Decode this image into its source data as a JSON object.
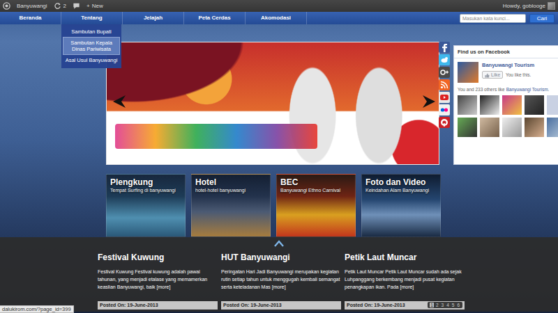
{
  "admin_bar": {
    "site": "Banyuwangi",
    "updates": "2",
    "new_icon": "+",
    "new_label": "New",
    "greeting": "Howdy, goblooge"
  },
  "nav": {
    "items": [
      {
        "label": "Beranda",
        "expanded": false
      },
      {
        "label": "Tentang",
        "expanded": true,
        "children": [
          {
            "label": "Sambutan Bupati",
            "selected": false
          },
          {
            "label": "Sambutan Kepala Dinas Pariwisata",
            "selected": true
          },
          {
            "label": "Asal Usul Banyuwangi",
            "selected": false
          }
        ]
      },
      {
        "label": "Jelajah",
        "expanded": false
      },
      {
        "label": "Peta Cerdas",
        "expanded": false
      },
      {
        "label": "Akomodasi",
        "expanded": false
      }
    ]
  },
  "search": {
    "placeholder": "Masukan kata kunci...",
    "button": "Cari"
  },
  "social": [
    {
      "kind": "facebook",
      "color": "#3b5998"
    },
    {
      "kind": "twitter",
      "color": "#3fb8ec"
    },
    {
      "kind": "googleplus",
      "color": "#4a4a4a"
    },
    {
      "kind": "rss",
      "color": "#f26522"
    },
    {
      "kind": "youtube",
      "color": "#e9e9e9"
    },
    {
      "kind": "flickr",
      "color": "#f2f2f2"
    },
    {
      "kind": "pinterest",
      "color": "#cb2027"
    }
  ],
  "facebook": {
    "title": "Find us on Facebook",
    "page": "Banyuwangi Tourism",
    "like": "Like",
    "liked": true,
    "like_note": "You like this.",
    "fans_prefix": "You and 233 others like",
    "fans_link": "Banyuwangi Tourism",
    "fans_suffix": "."
  },
  "tiles": [
    {
      "title": "Plengkung",
      "subtitle": "Tempat Surfing di banyuwangi"
    },
    {
      "title": "Hotel",
      "subtitle": "hotel-hotel banyuwangi"
    },
    {
      "title": "BEC",
      "subtitle": "Banyuwangi Ethno Carnival"
    },
    {
      "title": "Foto dan Video",
      "subtitle": "Keindahan Alam Banyuwangi"
    }
  ],
  "news": [
    {
      "title": "Festival Kuwung",
      "excerpt": "Festival Kuwung Festival kuwung adalah pawai tahunan, yang menjadi etalase yang memamerkan keaslian Banyuwangi, baik",
      "more": "[more]",
      "posted": "Posted On: 19-June-2013"
    },
    {
      "title": "HUT Banyuwangi",
      "excerpt": "Peringatan Hari Jadi Banyuwangi merupakan kegiatan rutin setiap tahun untuk menggugah kembali semangat serta keteladanan Mas",
      "more": "[more]",
      "posted": "Posted On: 19-June-2013"
    },
    {
      "title": "Petik Laut Muncar",
      "excerpt": "Petik Laut Muncar Petik Laut Muncar sudah ada sejak Luhpanggang berkembang menjadi pusat kegiatan penangkapan ikan. Pada",
      "more": "[more]",
      "posted": "Posted On: 19-June-2013"
    }
  ],
  "pagination": [
    {
      "label": "1",
      "selected": true
    },
    {
      "label": "2",
      "selected": false
    },
    {
      "label": "3",
      "selected": false
    },
    {
      "label": "4",
      "selected": false
    },
    {
      "label": "5",
      "selected": false
    },
    {
      "label": "6",
      "selected": false
    }
  ],
  "status_bar": "dalukirom.com/?page_id=399"
}
